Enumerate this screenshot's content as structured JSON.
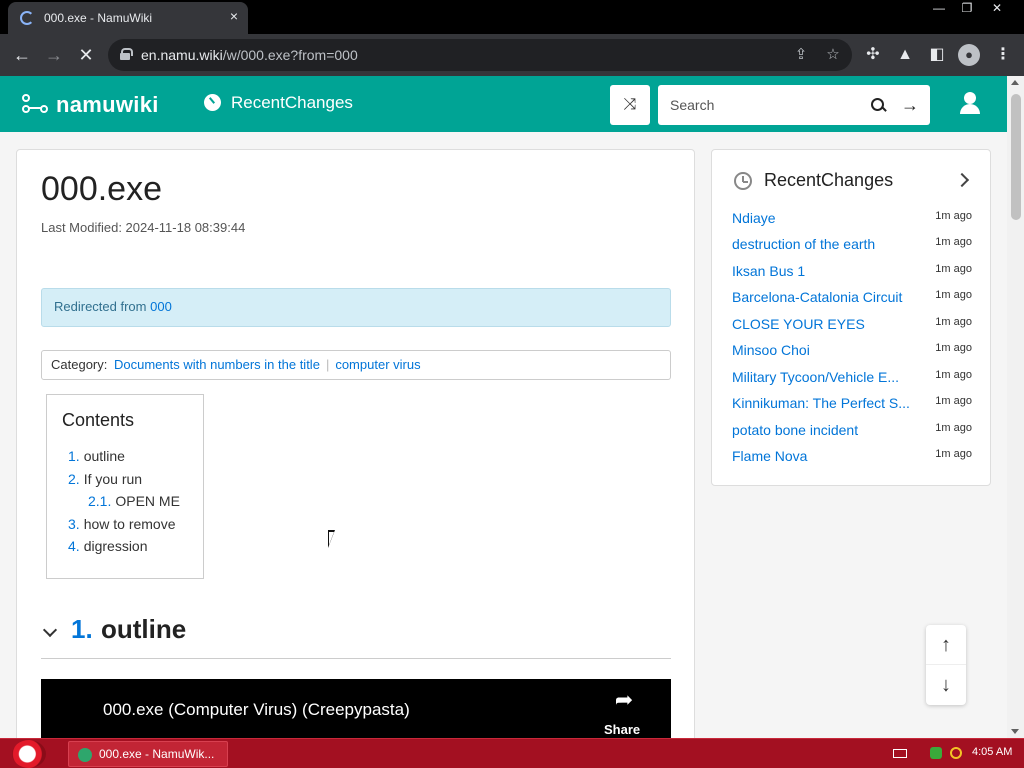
{
  "browser": {
    "tab_title": "000.exe - NamuWiki",
    "tab_close": "×",
    "url_host": "en.namu.wiki",
    "url_path": "/w/000.exe?from=000",
    "window_controls": {
      "minimize": "—",
      "maximize": "❐",
      "close": "✕"
    },
    "nav": {
      "back": "←",
      "forward": "→",
      "stop": "✕"
    },
    "icons": [
      "lock-icon",
      "share-icon",
      "star-icon",
      "extensions-icon",
      "lab-icon",
      "side-panel-icon",
      "profile-icon",
      "menu-icon"
    ]
  },
  "site": {
    "logo": "namuwiki",
    "nav_recent": "RecentChanges",
    "search_placeholder": "Search",
    "random_glyph": "⤨",
    "search_enter_glyph": "→",
    "brand_color": "#00a495"
  },
  "article": {
    "title": "000.exe",
    "last_modified": "Last Modified: 2024-11-18 08:39:44",
    "redirect_text": "Redirected from",
    "redirect_source": "000",
    "category_label": "Category:",
    "categories": [
      "Documents with numbers in the title",
      "computer virus"
    ],
    "toc_title": "Contents",
    "toc": [
      {
        "num": "1.",
        "label": "outline"
      },
      {
        "num": "2.",
        "label": "If you run"
      },
      {
        "num": "2.1.",
        "label": "OPEN ME"
      },
      {
        "num": "3.",
        "label": "how to remove"
      },
      {
        "num": "4.",
        "label": "digression"
      }
    ],
    "section": {
      "num": "1.",
      "label": "outline"
    },
    "video": {
      "title": "000.exe (Computer Virus) (Creepypasta)",
      "share_label": "Share"
    }
  },
  "recent_changes": {
    "title": "RecentChanges",
    "items": [
      {
        "title": "Ndiaye",
        "time": "1m ago"
      },
      {
        "title": "destruction of the earth",
        "time": "1m ago"
      },
      {
        "title": "Iksan Bus 1",
        "time": "1m ago"
      },
      {
        "title": "Barcelona-Catalonia Circuit",
        "time": "1m ago"
      },
      {
        "title": "CLOSE YOUR EYES",
        "time": "1m ago"
      },
      {
        "title": "Minsoo Choi",
        "time": "1m ago"
      },
      {
        "title": "Military Tycoon/Vehicle E...",
        "time": "1m ago"
      },
      {
        "title": "Kinnikuman: The Perfect S...",
        "time": "1m ago"
      },
      {
        "title": "potato bone incident",
        "time": "1m ago"
      },
      {
        "title": "Flame Nova",
        "time": "1m ago"
      }
    ]
  },
  "float_nav": {
    "up": "↑",
    "down": "↓"
  },
  "taskbar": {
    "task_label": "000.exe - NamuWik...",
    "clock": "4:05 AM"
  }
}
